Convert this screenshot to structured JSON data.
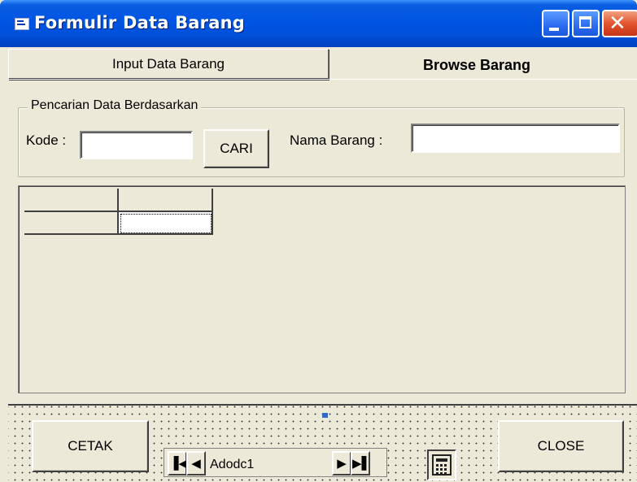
{
  "window": {
    "title": "Formulir Data Barang",
    "title_icon": "form-icon",
    "controls": [
      "minimize-icon",
      "maximize-icon",
      "close-icon"
    ],
    "colors": {
      "titlebar": "#0054e3",
      "face": "#ece9d8",
      "close": "#e2552e"
    }
  },
  "tabs": [
    {
      "label": "Input Data Barang",
      "active": false
    },
    {
      "label": "Browse Barang",
      "active": true
    }
  ],
  "search": {
    "group_label": "Pencarian Data Berdasarkan",
    "kode_label": "Kode :",
    "kode_value": "",
    "cari_label": "CARI",
    "nama_label": "Nama Barang  :",
    "nama_value": ""
  },
  "grid": {
    "columns": [
      "",
      ""
    ],
    "rows": [
      [
        "",
        ""
      ]
    ]
  },
  "footer": {
    "cetak_label": "CETAK",
    "close_label": "CLOSE",
    "adodc_caption": "Adodc1",
    "nav_icons": [
      "first-record-icon",
      "previous-record-icon",
      "next-record-icon",
      "last-record-icon"
    ],
    "calculator_icon": "calculator-icon"
  }
}
